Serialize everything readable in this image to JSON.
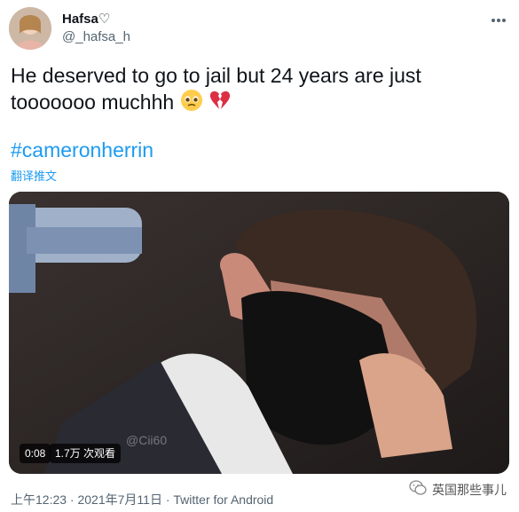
{
  "author": {
    "name": "Hafsa♡",
    "handle": "@_hafsa_h"
  },
  "menu_icon": "more-dots-icon",
  "tweet": {
    "text": "He deserved to go to jail but 24 years are just tooooooo muchhh",
    "emojis": [
      "pleading-face-emoji",
      "broken-heart-emoji"
    ],
    "hashtag": "#cameronherrin",
    "translate_label": "翻译推文"
  },
  "video": {
    "duration": "0:08",
    "views": "1.7万 次观看"
  },
  "footer": {
    "meta": "上午12:23 · 2021年7月11日 · Twitter for Android"
  },
  "watermark": {
    "icon": "wechat-icon",
    "text": "英国那些事儿"
  },
  "colors": {
    "accent": "#1d9bf0",
    "text": "#0f1419",
    "muted": "#536471"
  }
}
